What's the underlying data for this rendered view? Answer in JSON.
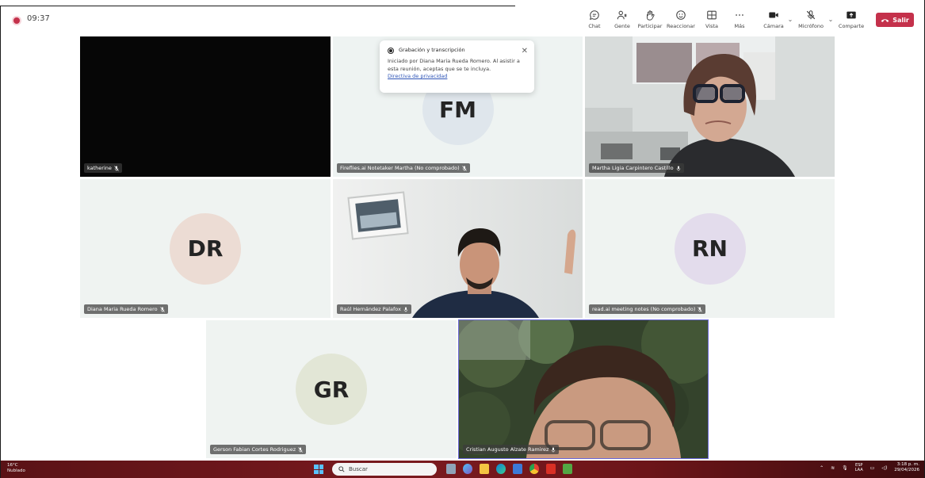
{
  "call": {
    "timer": "09:37"
  },
  "toolbar": {
    "chat": "Chat",
    "people": "Gente",
    "raise": "Participar",
    "react": "Reaccionar",
    "view": "Vista",
    "more": "Más",
    "camera": "Cámara",
    "mic": "Micrófono",
    "share": "Comparte",
    "leave": "Salir"
  },
  "popup": {
    "title": "Grabación y transcripción",
    "body": "Iniciado por Diana Maria Rueda Romero. Al asistir a esta reunión, aceptas que se te incluya.",
    "link": "Directiva de privacidad"
  },
  "participants": [
    {
      "name": "katherine"
    },
    {
      "name": "Fireflies.ai Notetaker Martha (No comprobado)",
      "initials": "FM"
    },
    {
      "name": "Martha Ligia Carpintero Castillo"
    },
    {
      "name": "Diana Maria Rueda Romero",
      "initials": "DR"
    },
    {
      "name": "Raúl Hernández Palafox"
    },
    {
      "name": "read.ai meeting notes (No comprobado)",
      "initials": "RN"
    },
    {
      "name": "Gerson Fabian Cortes Rodriguez",
      "initials": "GR"
    },
    {
      "name": "Cristian Augusto Alzate Ramirez"
    }
  ],
  "colors": {
    "leave": "#c4314b",
    "selected_border": "#6b68d8",
    "avatar_fm": "#dfe6ec",
    "avatar_dr": "#ecdcd4",
    "avatar_rn": "#e3dcec",
    "avatar_gr": "#e2e6d6"
  },
  "taskbar": {
    "weather_temp": "16°C",
    "weather_desc": "Nublado",
    "search": "Buscar",
    "lang_top": "ESP",
    "lang_bottom": "LAA",
    "time": "3:18 p. m.",
    "date": "29/04/2026"
  }
}
